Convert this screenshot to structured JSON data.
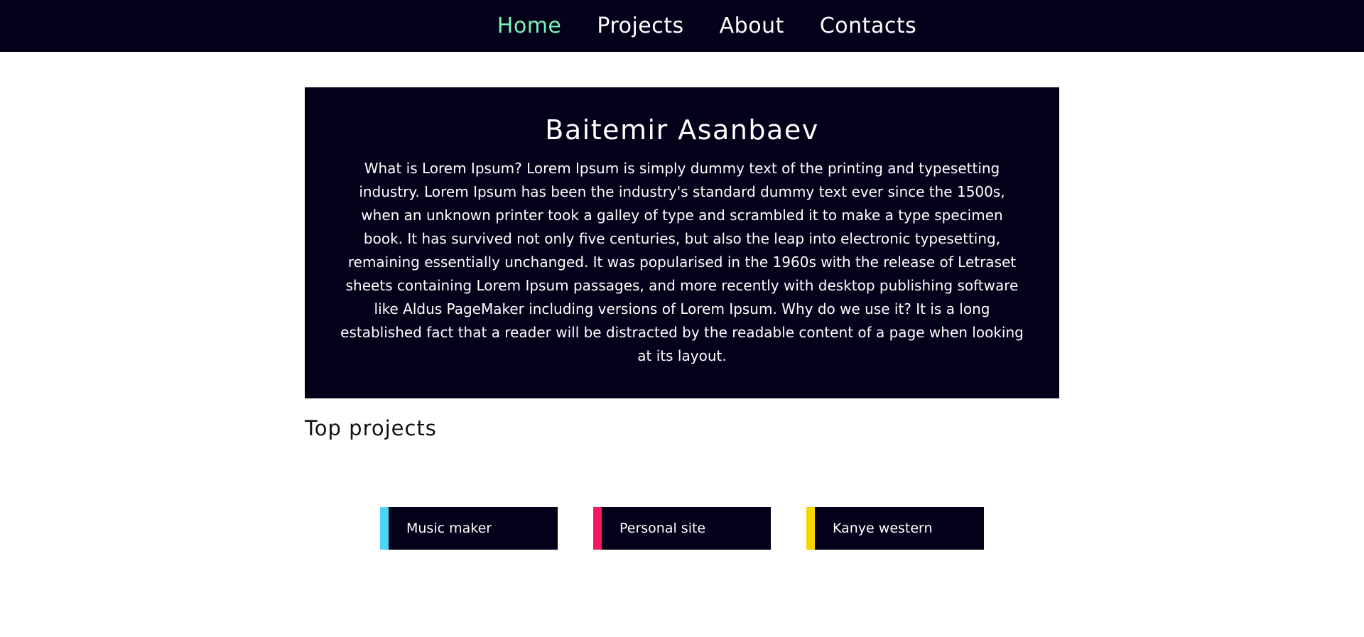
{
  "nav": {
    "items": [
      {
        "label": "Home",
        "active": true
      },
      {
        "label": "Projects",
        "active": false
      },
      {
        "label": "About",
        "active": false
      },
      {
        "label": "Contacts",
        "active": false
      }
    ],
    "active_color": "#7cf5b5",
    "background_color": "#03001a"
  },
  "hero": {
    "title": "Baitemir Asanbaev",
    "text": "What is Lorem Ipsum? Lorem Ipsum is simply dummy text of the printing and typesetting industry. Lorem Ipsum has been the industry's standard dummy text ever since the 1500s, when an unknown printer took a galley of type and scrambled it to make a type specimen book. It has survived not only five centuries, but also the leap into electronic typesetting, remaining essentially unchanged. It was popularised in the 1960s with the release of Letraset sheets containing Lorem Ipsum passages, and more recently with desktop publishing software like Aldus PageMaker including versions of Lorem Ipsum. Why do we use it? It is a long established fact that a reader will be distracted by the readable content of a page when looking at its layout."
  },
  "top_projects": {
    "heading": "Top projects",
    "items": [
      {
        "label": "Music maker",
        "accent": "#4dd4f5"
      },
      {
        "label": "Personal site",
        "accent": "#f5175f"
      },
      {
        "label": "Kanye western",
        "accent": "#f5d600"
      }
    ]
  }
}
